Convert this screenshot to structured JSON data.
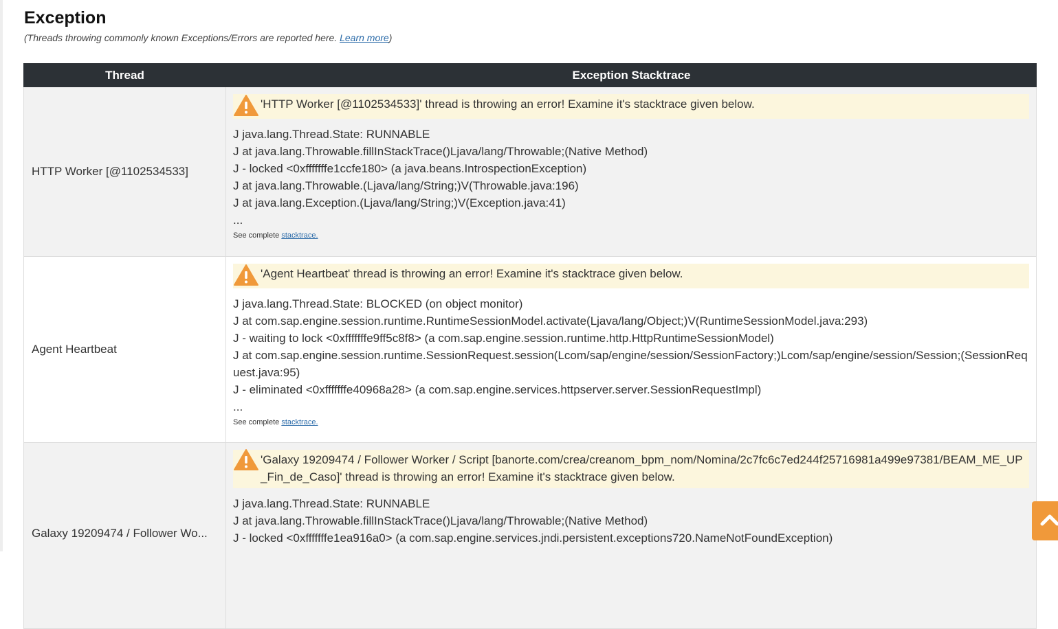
{
  "page": {
    "title": "Exception",
    "subtitle_prefix": "(Threads throwing commonly known Exceptions/Errors are reported here. ",
    "learn_more": "Learn more",
    "subtitle_suffix": ")"
  },
  "table": {
    "col_thread": "Thread",
    "col_trace": "Exception Stacktrace",
    "see_complete_prefix": "See complete ",
    "see_complete_link": "stacktrace.",
    "rows": [
      {
        "thread": "HTTP Worker [@1102534533]",
        "alert": "'HTTP Worker [@1102534533]' thread is throwing an error! Examine it's stacktrace given below.",
        "lines": [
          "J java.lang.Thread.State: RUNNABLE",
          "J at java.lang.Throwable.fillInStackTrace()Ljava/lang/Throwable;(Native Method)",
          "J - locked <0xfffffffe1ccfe180> (a java.beans.IntrospectionException)",
          "J at java.lang.Throwable.(Ljava/lang/String;)V(Throwable.java:196)",
          "J at java.lang.Exception.(Ljava/lang/String;)V(Exception.java:41)",
          "..."
        ]
      },
      {
        "thread": "Agent Heartbeat",
        "alert": "'Agent Heartbeat' thread is throwing an error! Examine it's stacktrace given below.",
        "lines": [
          "J java.lang.Thread.State: BLOCKED (on object monitor)",
          "J at com.sap.engine.session.runtime.RuntimeSessionModel.activate(Ljava/lang/Object;)V(RuntimeSessionModel.java:293)",
          "J - waiting to lock <0xfffffffe9ff5c8f8> (a com.sap.engine.session.runtime.http.HttpRuntimeSessionModel)",
          "J at com.sap.engine.session.runtime.SessionRequest.session(Lcom/sap/engine/session/SessionFactory;)Lcom/sap/engine/session/Session;(SessionRequest.java:95)",
          "J - eliminated <0xfffffffe40968a28> (a com.sap.engine.services.httpserver.server.SessionRequestImpl)",
          "..."
        ]
      },
      {
        "thread": "Galaxy 19209474 / Follower Wo...",
        "alert": "'Galaxy 19209474 / Follower Worker / Script [banorte.com/crea/creanom_bpm_nom/Nomina/2c7fc6c7ed244f25716981a499e97381/BEAM_ME_UP_Fin_de_Caso]' thread is throwing an error! Examine it's stacktrace given below.",
        "lines": [
          "J java.lang.Thread.State: RUNNABLE",
          "J at java.lang.Throwable.fillInStackTrace()Ljava/lang/Throwable;(Native Method)",
          "J - locked <0xfffffffe1ea916a0> (a com.sap.engine.services.jndi.persistent.exceptions720.NameNotFoundException)"
        ]
      }
    ]
  },
  "colors": {
    "header_bg": "#2c3136",
    "alert_bg": "#fcf6dd",
    "warning": "#f0993a",
    "link": "#2a6aa8"
  },
  "icons": {
    "alert": "warning-triangle-icon",
    "scroll_top": "chevron-up-icon"
  }
}
